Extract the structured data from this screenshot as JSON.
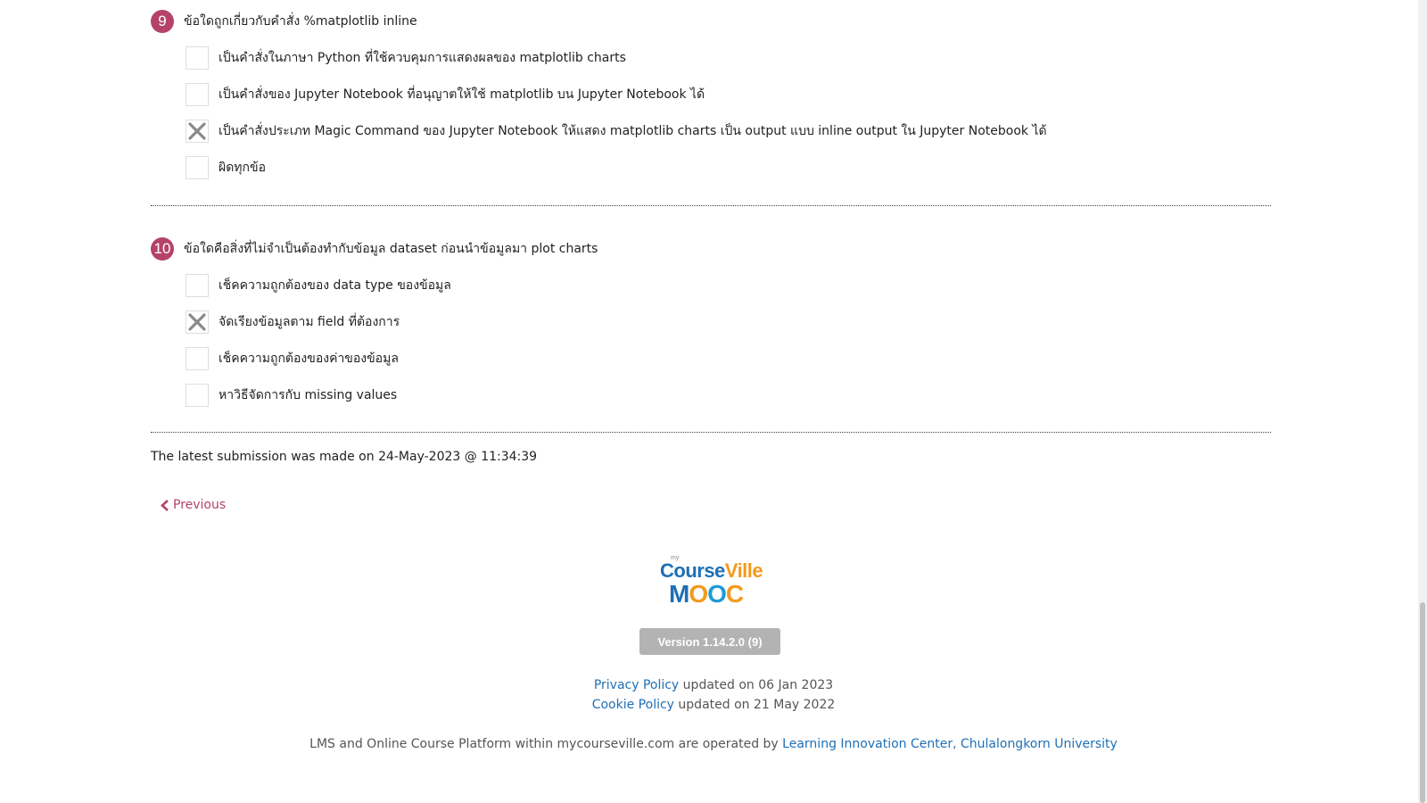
{
  "questions": [
    {
      "number": "9",
      "text": "ข้อใดถูกเกี่ยวกับคำสั่ง %matplotlib inline",
      "options": [
        {
          "label": "เป็นคำสั่งในภาษา Python ที่ใช้ควบคุมการแสดงผลของ matplotlib charts",
          "checked": false
        },
        {
          "label": "เป็นคำสั่งของ Jupyter Notebook ที่อนุญาตให้ใช้ matplotlib บน Jupyter Notebook ได้",
          "checked": false
        },
        {
          "label": "เป็นคำสั่งประเภท Magic Command ของ Jupyter Notebook ให้แสดง matplotlib charts เป็น output แบบ inline output ใน Jupyter Notebook ได้",
          "checked": true
        },
        {
          "label": "ผิดทุกข้อ",
          "checked": false
        }
      ]
    },
    {
      "number": "10",
      "text": "ข้อใดคือสิ่งที่ไม่จำเป็นต้องทำกับข้อมูล dataset ก่อนนำข้อมูลมา plot charts",
      "options": [
        {
          "label": "เช็คความถูกต้องของ data type ของข้อมูล",
          "checked": false
        },
        {
          "label": "จัดเรียงข้อมูลตาม field ที่ต้องการ",
          "checked": true
        },
        {
          "label": "เช็คความถูกต้องของค่าของข้อมูล",
          "checked": false
        },
        {
          "label": "หาวิธีจัดการกับ missing values",
          "checked": false
        }
      ]
    }
  ],
  "submission_text": "The latest submission was made on 24-May-2023 @ 11:34:39",
  "nav": {
    "previous_label": "Previous"
  },
  "footer": {
    "logo": {
      "my": "my",
      "course": "Course",
      "ville": "Ville",
      "mooc_m": "M",
      "mooc_o1": "O",
      "mooc_o2": "O",
      "mooc_c": "C"
    },
    "version_label": "Version 1.14.2.0 (9)",
    "privacy_link": "Privacy Policy",
    "privacy_updated": " updated on 06 Jan 2023",
    "cookie_link": "Cookie Policy",
    "cookie_updated": " updated on 21 May 2022",
    "operated_text": "LMS and Online Course Platform within mycourseville.com are operated by ",
    "operated_link": "Learning Innovation Center, Chulalongkorn University"
  },
  "colors": {
    "accent": "#b5426a",
    "link": "#1e6fb5",
    "version_bg": "#b3b3b3"
  }
}
